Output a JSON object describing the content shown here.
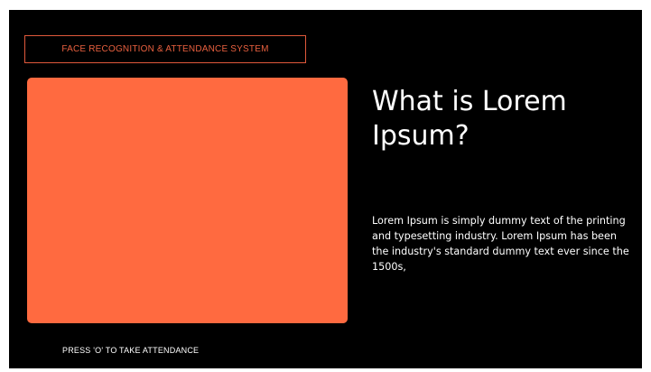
{
  "header": {
    "title": "FACE RECOGNITION & ATTENDANCE SYSTEM"
  },
  "content": {
    "heading": "What is Lorem Ipsum?",
    "description": "Lorem Ipsum is simply dummy text of the printing and typesetting industry. Lorem Ipsum has been the industry's standard dummy text ever since the 1500s,"
  },
  "footer": {
    "instruction": "PRESS 'O' TO TAKE ATTENDANCE"
  },
  "colors": {
    "background": "#000000",
    "accent": "#ff6a40",
    "title_border": "#e0593b"
  }
}
